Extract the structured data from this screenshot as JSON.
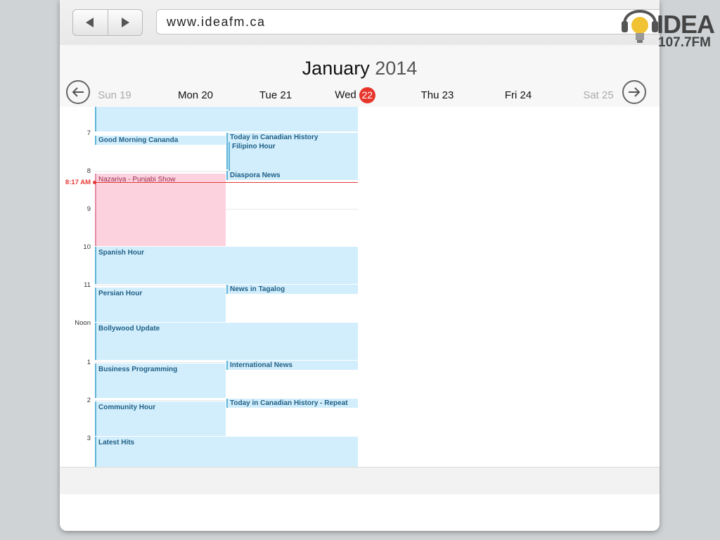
{
  "browser": {
    "url": "www.ideafm.ca",
    "back_icon": "triangle-left-icon",
    "forward_icon": "triangle-right-icon"
  },
  "calendar": {
    "month": "January",
    "year": "2014",
    "prev_icon": "arrow-left-circle-icon",
    "next_icon": "arrow-right-circle-icon",
    "days": [
      {
        "label": "Sun 19"
      },
      {
        "label": "Mon 20"
      },
      {
        "label": "Tue 21"
      },
      {
        "label": "Wed"
      },
      {
        "label": "Thu 23"
      },
      {
        "label": "Fri 24"
      },
      {
        "label": "Sat 25"
      }
    ],
    "today_number": "22",
    "current_time_label": "8:17 AM",
    "hours": [
      "7",
      "8",
      "9",
      "10",
      "11",
      "Noon",
      "1",
      "2",
      "3"
    ],
    "events": {
      "good_morning": "Good Morning Cananda",
      "today_history": "Today in Canadian History",
      "filipino": "Filipino Hour",
      "diaspora": "Diaspora News",
      "nazariya": "Nazariya - Punjabi Show",
      "spanish": "Spanish Hour",
      "persian": "Persian Hour",
      "tagalog": "News in Tagalog",
      "bollywood": "Bollywood Update",
      "business": "Business Programming",
      "international": "International News",
      "community": "Community Hour",
      "history_repeat": "Today in Canadian History - Repeat",
      "latest_hits": "Latest Hits"
    }
  },
  "logo": {
    "name": "IDEA",
    "frequency": "107.7FM",
    "icon": "lightbulb-headphones-icon"
  },
  "colors": {
    "event_blue": "#d2eefc",
    "event_pink": "#fcd2de",
    "today_red": "#e8352b",
    "now_line": "#e53935"
  }
}
